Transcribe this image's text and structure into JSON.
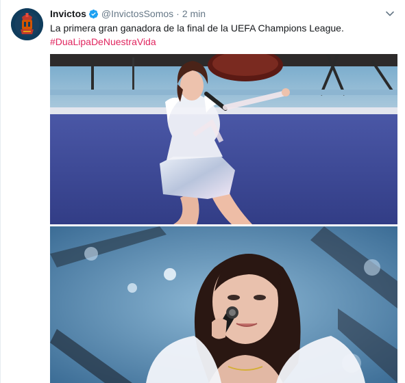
{
  "tweet": {
    "display_name": "Invictos",
    "verified": true,
    "handle": "@InvictosSomos",
    "separator": "·",
    "time": "2 min",
    "text": "La primera gran ganadora de la final de la UEFA Champions League.",
    "hashtag": "#DuaLipaDeNuestraVida"
  },
  "media": {
    "photo_count": 2
  },
  "icons": {
    "verified": "verified-badge-icon",
    "menu": "chevron-down-icon"
  },
  "colors": {
    "link": "#1da1f2",
    "hashtag": "#e0245e",
    "verified_badge": "#1da1f2",
    "secondary_text": "#657786"
  }
}
